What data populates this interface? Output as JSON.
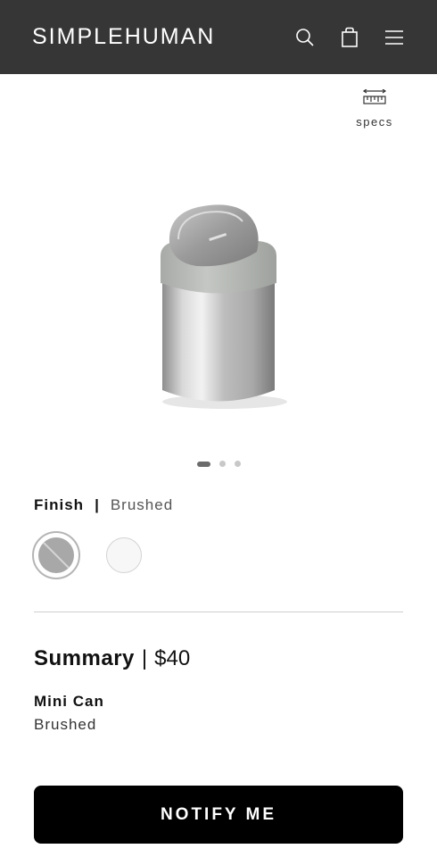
{
  "header": {
    "logo": "SIMPLEHUMAN",
    "icons": [
      "search-icon",
      "shopping-bag-icon",
      "menu-icon"
    ],
    "background_color": "#363636"
  },
  "specs": {
    "label": "specs",
    "icon": "ruler-icon"
  },
  "gallery": {
    "slide_count": 3,
    "active_index": 0
  },
  "finish": {
    "label": "Finish",
    "separator": "|",
    "selected_value": "Brushed",
    "options": [
      {
        "name": "brushed",
        "color": "#a8a8a8",
        "selected": true
      },
      {
        "name": "white",
        "color": "#f7f7f7",
        "selected": false
      }
    ]
  },
  "summary": {
    "label": "Summary",
    "separator": "|",
    "price": "$40",
    "item_name": "Mini Can",
    "item_finish": "Brushed"
  },
  "cta": {
    "label": "NOTIFY ME",
    "color": "#000000"
  }
}
